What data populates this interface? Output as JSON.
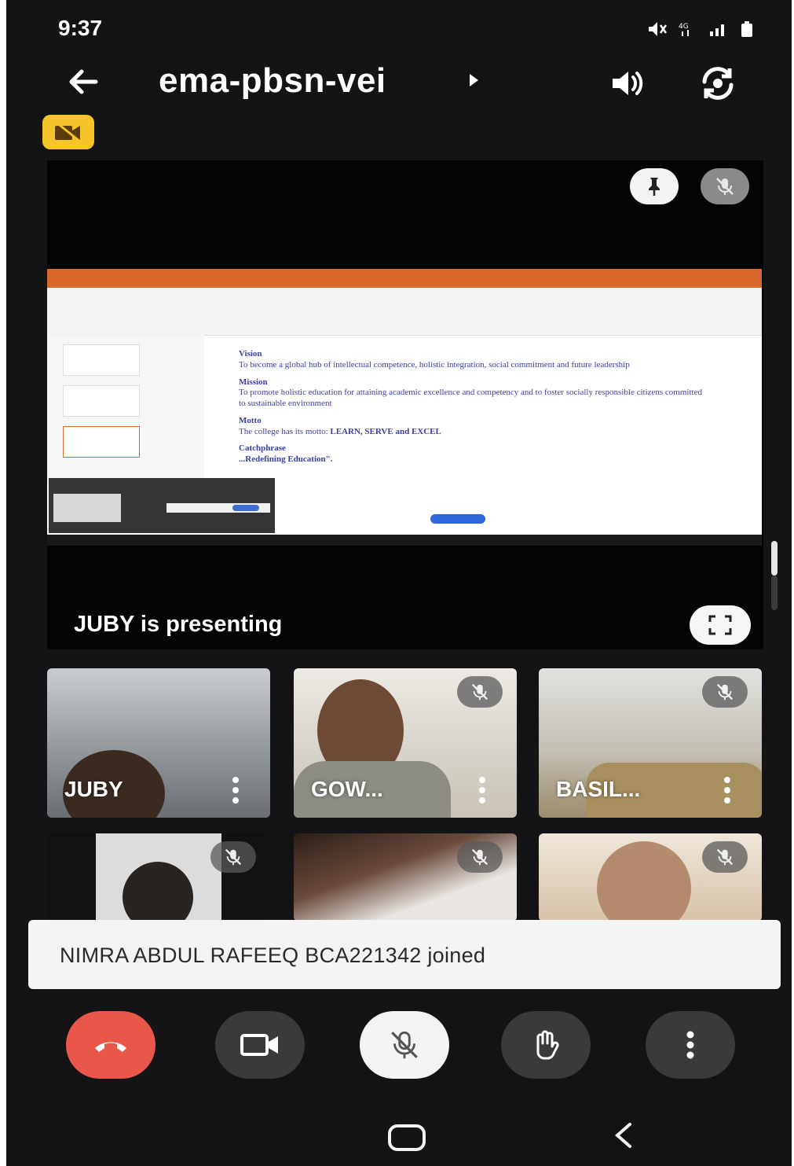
{
  "status": {
    "time": "9:37"
  },
  "header": {
    "meeting_code": "ema-pbsn-vei"
  },
  "presentation": {
    "presenting_label": "JUBY is presenting",
    "slide": {
      "heading_vision": "Vision",
      "vision_text": "To become a global hub of intellectual competence, holistic integration, social commitment and future leadership",
      "heading_mission": "Mission",
      "mission_text": "To promote holistic education for attaining academic excellence and competency and to foster socially responsible citizens committed to sustainable environment",
      "heading_motto": "Motto",
      "motto_prefix": "The college has its motto:",
      "motto_value": "LEARN, SERVE and EXCEL",
      "heading_catchphrase": "Catchphrase",
      "catchphrase_text": "...Redefining Education\"."
    }
  },
  "participants": [
    {
      "name": "JUBY",
      "muted": false
    },
    {
      "name": "GOW...",
      "muted": true
    },
    {
      "name": "BASIL...",
      "muted": true
    },
    {
      "name": "",
      "muted": true
    },
    {
      "name": "",
      "muted": true
    },
    {
      "name": "",
      "muted": true
    }
  ],
  "toast": {
    "message": "NIMRA ABDUL RAFEEQ BCA221342 joined"
  },
  "icons": {
    "back": "arrow-left-icon",
    "speaker": "speaker-icon",
    "switch_camera": "switch-camera-icon",
    "camera_off": "camera-off-icon",
    "pin": "pin-icon",
    "mic_off": "mic-off-icon",
    "fullscreen": "fullscreen-icon",
    "end_call": "end-call-icon",
    "camera": "camera-icon",
    "hand": "raise-hand-icon",
    "more": "more-vert-icon"
  },
  "colors": {
    "end_call": "#e8574a",
    "camera_off_badge": "#f4c42a",
    "ppt_ribbon": "#d9682c"
  }
}
